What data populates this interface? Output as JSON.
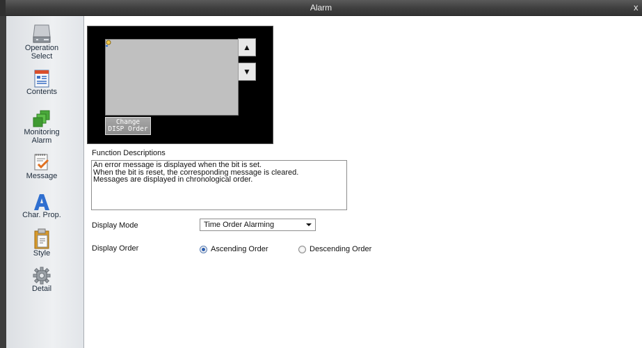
{
  "window": {
    "title": "Alarm",
    "close_glyph": "x"
  },
  "sidebar": {
    "items": [
      {
        "label_line1": "Operation",
        "label_line2": "Select",
        "icon": "operation-select-icon"
      },
      {
        "label_line1": "Contents",
        "label_line2": "",
        "icon": "contents-icon"
      },
      {
        "label_line1": "Monitoring",
        "label_line2": "Alarm",
        "icon": "monitoring-alarm-icon"
      },
      {
        "label_line1": "Message",
        "label_line2": "",
        "icon": "message-icon"
      },
      {
        "label_line1": "Char. Prop.",
        "label_line2": "",
        "icon": "char-prop-icon"
      },
      {
        "label_line1": "Style",
        "label_line2": "",
        "icon": "style-icon"
      },
      {
        "label_line1": "Detail",
        "label_line2": "",
        "icon": "gear-icon"
      }
    ]
  },
  "preview": {
    "change_button_line1": "Change",
    "change_button_line2": "DISP Order",
    "up_glyph": "▲",
    "down_glyph": "▼"
  },
  "function_descriptions": {
    "label": "Function Descriptions",
    "lines": [
      "An error message is displayed when the bit is set.",
      "When the bit is reset, the corresponding message is cleared.",
      "Messages are displayed in chronological order."
    ]
  },
  "display_mode": {
    "label": "Display Mode",
    "selected": "Time Order Alarming"
  },
  "display_order": {
    "label": "Display Order",
    "options": [
      {
        "label": "Ascending Order",
        "selected": true
      },
      {
        "label": "Descending Order",
        "selected": false
      }
    ]
  },
  "colors": {
    "titlebar": "#3e3e3e",
    "sidebar": "#eef0f2",
    "preview_bg": "#000000",
    "preview_screen": "#c0c0c0",
    "radio_selected": "#2a5db0"
  }
}
